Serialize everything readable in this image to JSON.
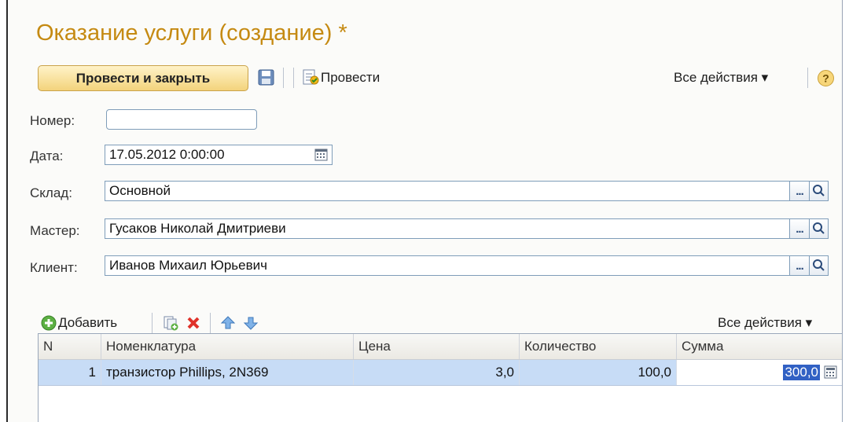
{
  "window": {
    "title": "Оказание услуги (создание) *"
  },
  "toolbar": {
    "post_and_close_label": "Провести и закрыть",
    "post_label": "Провести",
    "all_actions_label": "Все действия ▾",
    "icons": {
      "save": "save-icon",
      "post": "post-document-icon",
      "help": "help-icon"
    }
  },
  "fields": {
    "number": {
      "label": "Номер:",
      "value": ""
    },
    "date": {
      "label": "Дата:",
      "value": "17.05.2012  0:00:00"
    },
    "warehouse": {
      "label": "Склад:",
      "value": "Основной"
    },
    "master": {
      "label": "Мастер:",
      "value": "Гусаков Николай Дмитриеви"
    },
    "client": {
      "label": "Клиент:",
      "value": "Иванов Михаил Юрьевич"
    },
    "select_button_label": "..."
  },
  "table_toolbar": {
    "add_label": "Добавить",
    "all_actions_label": "Все действия ▾",
    "icons": [
      "add-icon",
      "copy-icon",
      "delete-icon",
      "move-up-icon",
      "move-down-icon"
    ]
  },
  "table": {
    "columns": [
      "N",
      "Номенклатура",
      "Цена",
      "Количество",
      "Сумма"
    ],
    "rows": [
      {
        "n": "1",
        "item": "транзистор Phillips, 2N369",
        "price": "3,0",
        "quantity": "100,0",
        "sum": "300,0"
      }
    ]
  },
  "colors": {
    "title": "#c58a12",
    "selected_row": "#c7dcf6",
    "primary_button": "#f3d37c"
  }
}
